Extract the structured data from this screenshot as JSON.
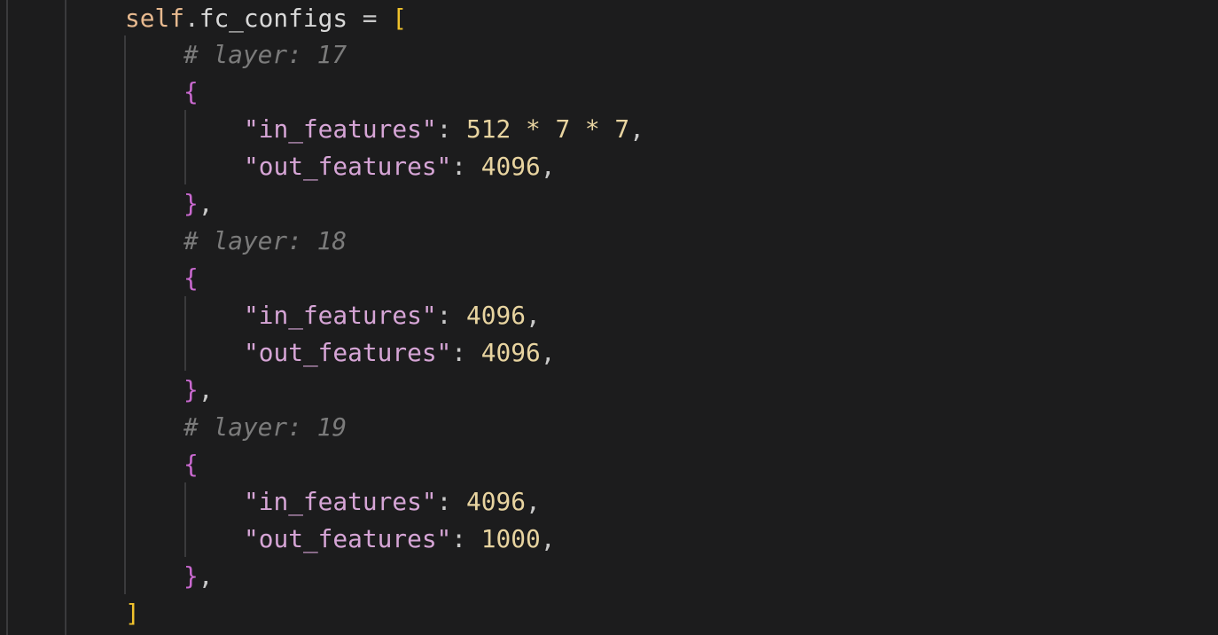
{
  "code": {
    "header": {
      "self": "self",
      "dot": ".",
      "attr": "fc_configs",
      "assign": " = ",
      "open_bracket": "["
    },
    "blocks": [
      {
        "comment": "# layer: 17",
        "open_brace": "{",
        "in_key": "\"in_features\"",
        "in_colon": ": ",
        "in_value": "512 * 7 * 7",
        "in_comma": ",",
        "out_key": "\"out_features\"",
        "out_colon": ": ",
        "out_value": "4096",
        "out_comma": ",",
        "close_brace": "}",
        "close_comma": ","
      },
      {
        "comment": "# layer: 18",
        "open_brace": "{",
        "in_key": "\"in_features\"",
        "in_colon": ": ",
        "in_value": "4096",
        "in_comma": ",",
        "out_key": "\"out_features\"",
        "out_colon": ": ",
        "out_value": "4096",
        "out_comma": ",",
        "close_brace": "}",
        "close_comma": ","
      },
      {
        "comment": "# layer: 19",
        "open_brace": "{",
        "in_key": "\"in_features\"",
        "in_colon": ": ",
        "in_value": "4096",
        "in_comma": ",",
        "out_key": "\"out_features\"",
        "out_colon": ": ",
        "out_value": "1000",
        "out_comma": ",",
        "close_brace": "}",
        "close_comma": ","
      }
    ],
    "footer": {
      "close_bracket": "]"
    }
  },
  "colors": {
    "background": "#1c1c1d",
    "keyword_self": "#e7b98f",
    "bracket_outer": "#f0c22c",
    "bracket_inner": "#c969cf",
    "comment": "#7b7b7b",
    "string": "#d6a5d6",
    "number": "#e8d4a0",
    "indent_guide": "#3a3a3c"
  }
}
